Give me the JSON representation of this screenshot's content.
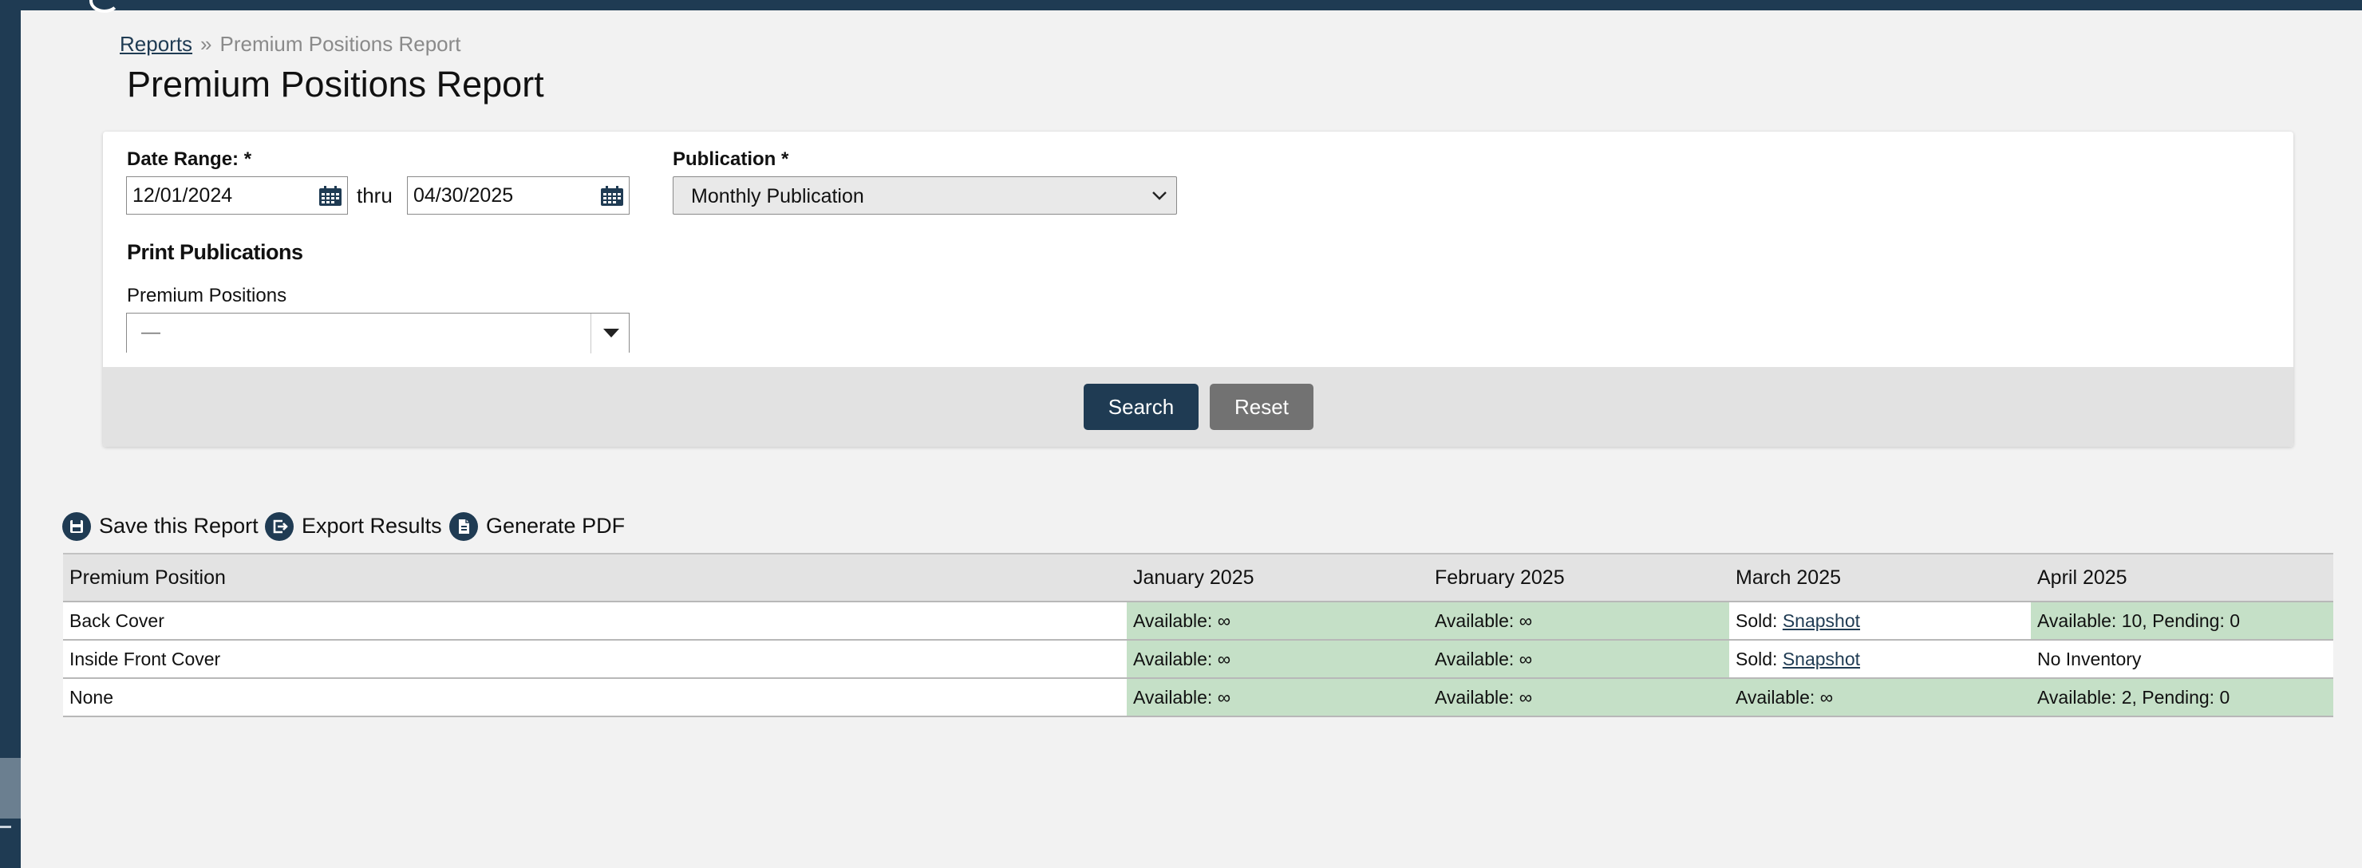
{
  "colors": {
    "brand": "#1f3b53",
    "available_cell": "#c5e0c7",
    "reset_button": "#727272",
    "panel_footer": "#e2e2e2"
  },
  "breadcrumb": {
    "root": "Reports",
    "separator": "»",
    "current": "Premium Positions Report"
  },
  "page_title": "Premium Positions Report",
  "form": {
    "date_range_label": "Date Range: *",
    "start_date": "12/01/2024",
    "thru_label": "thru",
    "end_date": "04/30/2025",
    "publication_label": "Publication *",
    "publication_value": "Monthly Publication",
    "section_title": "Print Publications",
    "premium_positions_label": "Premium Positions",
    "premium_positions_value": "—",
    "icons": {
      "calendar": "calendar-icon",
      "dropdown": "chevron-down-icon",
      "combo_caret": "caret-down-icon"
    }
  },
  "buttons": {
    "search": "Search",
    "reset": "Reset"
  },
  "actions": {
    "save": {
      "label": "Save this Report",
      "icon": "save-icon"
    },
    "export": {
      "label": "Export Results",
      "icon": "export-icon"
    },
    "pdf": {
      "label": "Generate PDF",
      "icon": "pdf-icon"
    }
  },
  "table": {
    "headers": [
      "Premium Position",
      "January 2025",
      "February 2025",
      "March 2025",
      "April 2025"
    ],
    "rows": [
      {
        "position": "Back Cover",
        "jan": "Available: ∞",
        "feb": "Available: ∞",
        "mar": {
          "prefix": "Sold:",
          "link": "Snapshot"
        },
        "apr": "Available: 10, Pending: 0"
      },
      {
        "position": "Inside Front Cover",
        "jan": "Available: ∞",
        "feb": "Available: ∞",
        "mar": {
          "prefix": "Sold:",
          "link": "Snapshot"
        },
        "apr": "No Inventory"
      },
      {
        "position": "None",
        "jan": "Available: ∞",
        "feb": "Available: ∞",
        "mar": "Available: ∞",
        "apr": "Available: 2, Pending: 0"
      }
    ]
  }
}
